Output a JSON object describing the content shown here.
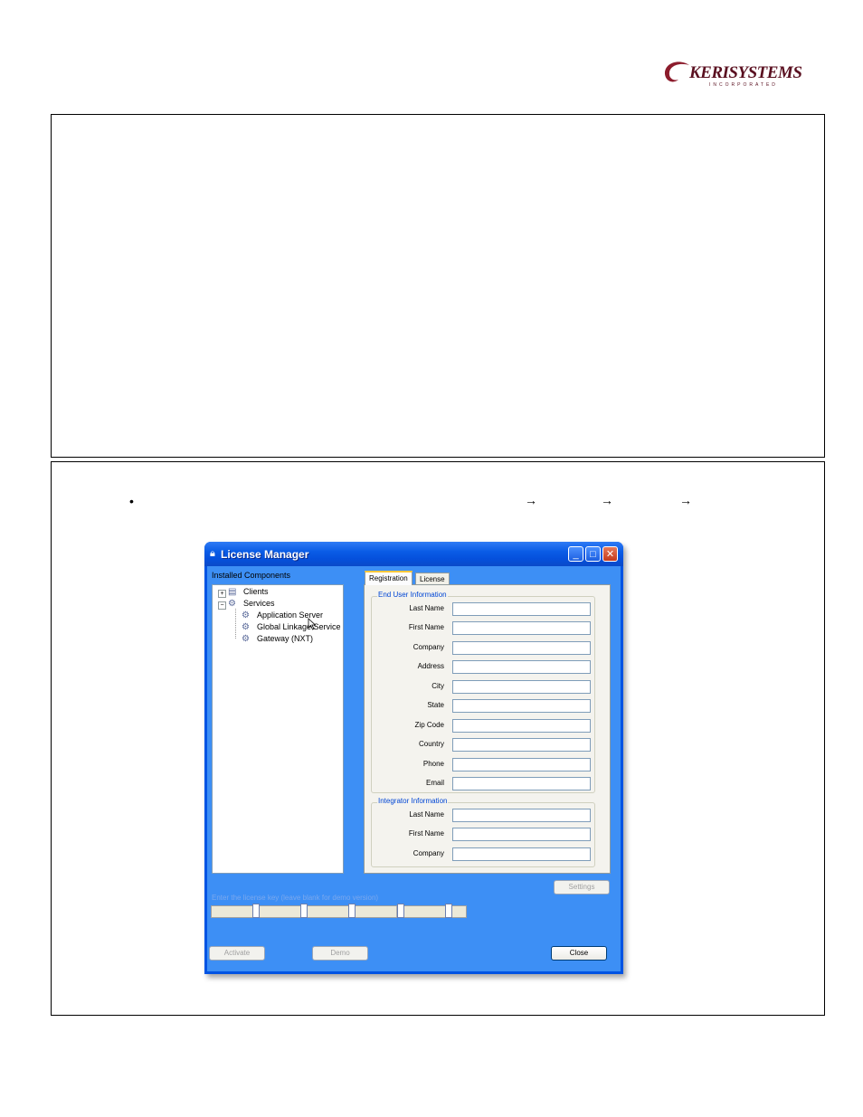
{
  "logo": {
    "word": "KERISYSTEMS",
    "sub": "INCORPORATED"
  },
  "window": {
    "title": "License Manager",
    "installed_label": "Installed Components",
    "tree": [
      {
        "label": "Clients"
      },
      {
        "label": "Services"
      },
      {
        "label": "Application Server"
      },
      {
        "label": "Global Linkage Service"
      },
      {
        "label": "Gateway (NXT)"
      }
    ],
    "tabs": {
      "registration": "Registration",
      "license": "License"
    },
    "end_user": {
      "title": "End User Information",
      "fields": [
        "Last Name",
        "First Name",
        "Company",
        "Address",
        "City",
        "State",
        "Zip Code",
        "Country",
        "Phone",
        "Email"
      ]
    },
    "integrator": {
      "title": "Integrator Information",
      "fields": [
        "Last Name",
        "First Name",
        "Company"
      ]
    },
    "buttons": {
      "settings": "Settings",
      "activate": "Activate",
      "demo": "Demo",
      "close": "Close"
    },
    "key_label": "Enter the license key (leave blank for demo version)"
  },
  "bullet": "•",
  "arrows": [
    "→",
    "→",
    "→"
  ]
}
